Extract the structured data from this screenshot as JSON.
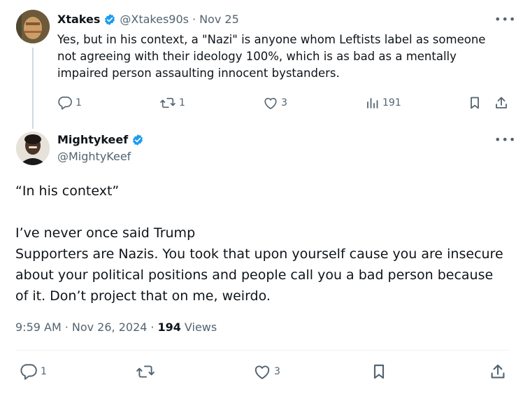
{
  "reply_tweet": {
    "display_name": "Xtakes",
    "handle": "@Xtakes90s",
    "separator": "·",
    "date": "Nov 25",
    "text": "Yes, but in his context, a \"Nazi\" is anyone whom Leftists label as someone not agreeing with their ideology 100%, which is as bad as a mentally impaired person assaulting innocent bystanders.",
    "replies": "1",
    "reposts": "1",
    "likes": "3",
    "views": "191"
  },
  "main_tweet": {
    "display_name": "Mightykeef",
    "handle": "@MightyKeef",
    "paragraph1": "“In his context”",
    "paragraph2": "I’ve never once said Trump\nSupporters are Nazis. You took that upon yourself cause you are insecure about your political positions and people call you a bad person because of it. Don’t project that on me, weirdo.",
    "time": "9:59 AM",
    "date": "Nov 26, 2024",
    "separator": "·",
    "views_count": "194",
    "views_label": "Views",
    "replies": "1",
    "likes": "3"
  },
  "icons": {
    "verified": "verified-badge-icon",
    "more": "more-horizontal-icon",
    "reply": "reply-icon",
    "repost": "repost-icon",
    "like": "heart-icon",
    "views": "analytics-icon",
    "bookmark": "bookmark-icon",
    "share": "share-icon"
  },
  "colors": {
    "verified": "#1d9bf0",
    "muted": "#536471",
    "text": "#0f1419"
  }
}
